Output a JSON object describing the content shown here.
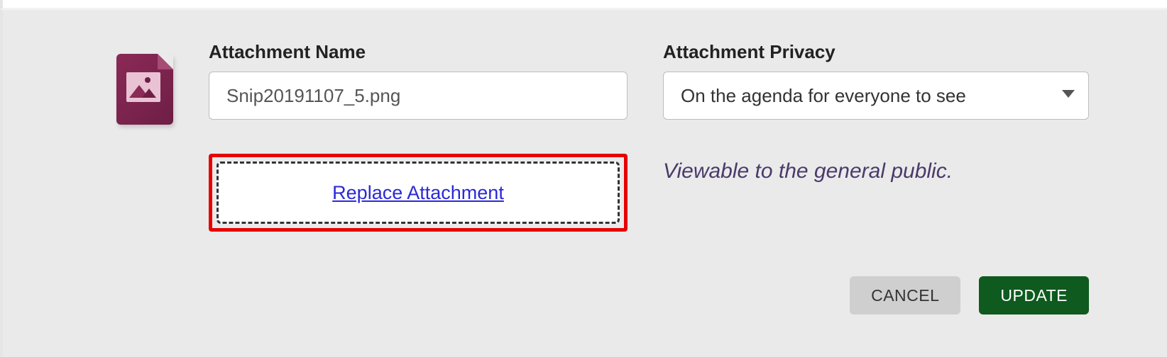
{
  "attachment": {
    "name_label": "Attachment Name",
    "name_value": "Snip20191107_5.png",
    "replace_link": "Replace Attachment"
  },
  "privacy": {
    "label": "Attachment Privacy",
    "selected": "On the agenda for everyone to see",
    "hint": "Viewable to the general public."
  },
  "buttons": {
    "cancel": "CANCEL",
    "update": "UPDATE"
  }
}
